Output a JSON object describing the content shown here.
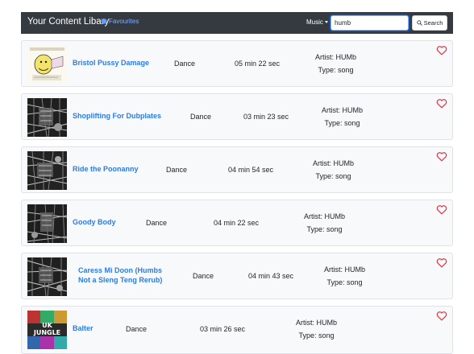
{
  "navbar": {
    "brand": "Your Content Libary",
    "favourites_label": "Favourites",
    "music_label": "Music",
    "search_value": "humb",
    "search_button": "Search"
  },
  "colors": {
    "navbar": "#343a40",
    "link": "#2c7be5",
    "heart": "#dc3545",
    "card_bg": "#f8f9fa"
  },
  "songs": [
    {
      "title": "Bristol Pussy Damage",
      "genre": "Dance",
      "duration": "05 min 22 sec",
      "artist": "Artist: HUMb",
      "type": "Type: song",
      "thumb_icon": "poster-art-thumbnail"
    },
    {
      "title": "Shoplifting For Dubplates",
      "genre": "Dance",
      "duration": "03 min 23 sec",
      "artist": "Artist: HUMb",
      "type": "Type: song",
      "thumb_icon": "grayscale-art-thumbnail"
    },
    {
      "title": "Ride the Poonanny",
      "genre": "Dance",
      "duration": "04 min 54 sec",
      "artist": "Artist: HUMb",
      "type": "Type: song",
      "thumb_icon": "grayscale-art-thumbnail"
    },
    {
      "title": "Goody Body",
      "genre": "Dance",
      "duration": "04 min 22 sec",
      "artist": "Artist: HUMb",
      "type": "Type: song",
      "thumb_icon": "grayscale-art-thumbnail"
    },
    {
      "title": "Caress Mi Doon (Humbs Not a Sleng Teng Rerub)",
      "genre": "Dance",
      "duration": "04 min 43 sec",
      "artist": "Artist: HUMb",
      "type": "Type: song",
      "thumb_icon": "grayscale-art-thumbnail"
    },
    {
      "title": "Balter",
      "genre": "Dance",
      "duration": "03 min 26 sec",
      "artist": "Artist: HUMb",
      "type": "Type: song",
      "thumb_icon": "uk-jungle-cover-thumbnail",
      "thumb_text": "UK JUNGLE"
    }
  ]
}
